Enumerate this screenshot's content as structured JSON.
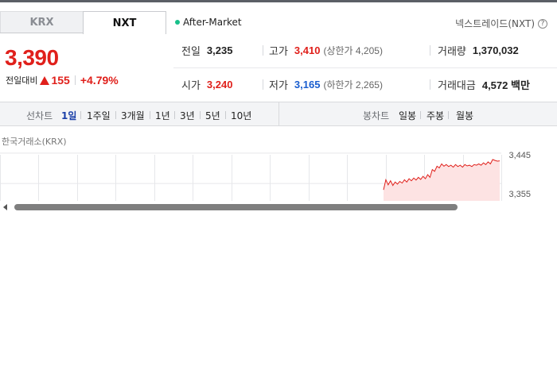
{
  "tabs": {
    "krx": "KRX",
    "nxt": "NXT"
  },
  "session": {
    "label": "After-Market",
    "indicator_color": "#18c08a"
  },
  "nxt_link": {
    "label": "넥스트레이드(NXT)",
    "help": "?"
  },
  "price": {
    "current": "3,390",
    "change_label": "전일대비",
    "change_amount": "155",
    "change_percent": "+4.79%",
    "direction": "up",
    "up_color": "#e0201b",
    "down_color": "#1a5ecf"
  },
  "stats": {
    "prev_close": {
      "label": "전일",
      "value": "3,235"
    },
    "high": {
      "label": "고가",
      "value": "3,410",
      "sub": "(상한가 4,205)"
    },
    "volume": {
      "label": "거래량",
      "value": "1,370,032"
    },
    "open": {
      "label": "시가",
      "value": "3,240"
    },
    "low": {
      "label": "저가",
      "value": "3,165",
      "sub": "(하한가 2,265)"
    },
    "amount": {
      "label": "거래대금",
      "value": "4,572 백만"
    }
  },
  "toolbar": {
    "line_chart_label": "선차트",
    "line_periods": [
      "1일",
      "1주일",
      "3개월",
      "1년",
      "3년",
      "5년",
      "10년"
    ],
    "active_period": "1일",
    "candle_chart_label": "봉차트",
    "candle_periods": [
      "일봉",
      "주봉",
      "월봉"
    ]
  },
  "chart": {
    "caption": "한국거래소(KRX)",
    "y_labels": [
      "3,445",
      "3,355"
    ],
    "line_color": "#e0201b",
    "fill_color": "#fde3e3"
  },
  "chart_data": {
    "type": "area",
    "title": "",
    "xlabel": "",
    "ylabel": "",
    "ylim": [
      3300,
      3460
    ],
    "y_ticks": [
      3445,
      3355
    ],
    "series": [
      {
        "values": [
          3335,
          3365,
          3350,
          3362,
          3348,
          3358,
          3352,
          3360,
          3355,
          3365,
          3358,
          3368,
          3362,
          3370,
          3364,
          3372,
          3366,
          3375,
          3368,
          3380,
          3372,
          3395,
          3390,
          3405,
          3400,
          3412,
          3405,
          3410,
          3404,
          3408,
          3402,
          3410,
          3404,
          3408,
          3402,
          3410,
          3406,
          3408,
          3404,
          3410,
          3408,
          3412,
          3408,
          3415,
          3410,
          3418,
          3412,
          3425,
          3422,
          3420,
          3421
        ]
      }
    ]
  }
}
